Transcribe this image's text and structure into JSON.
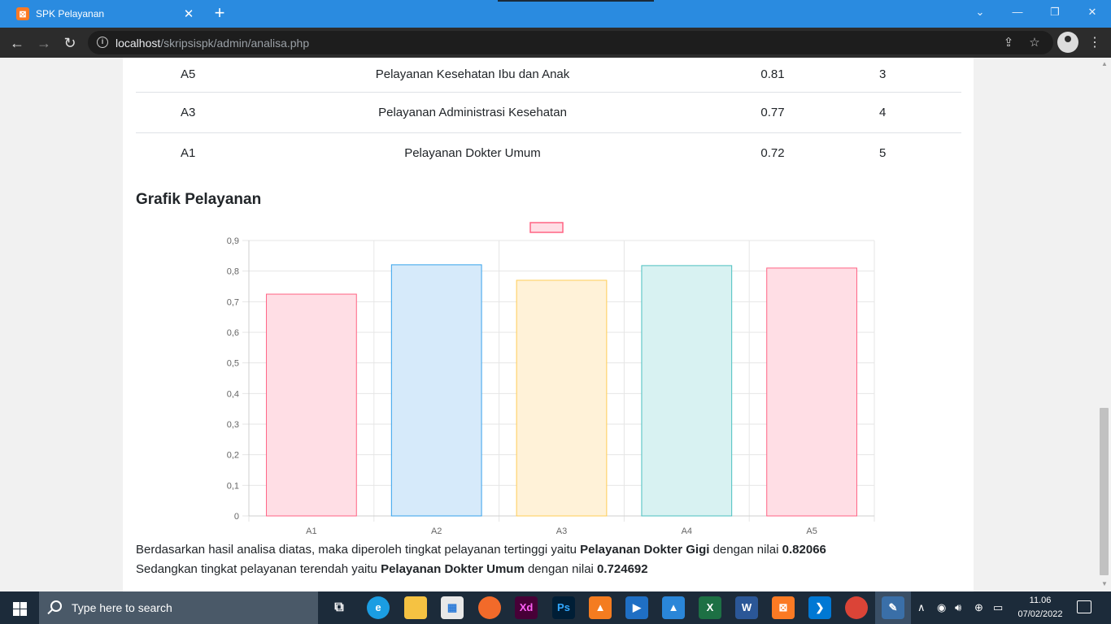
{
  "browser": {
    "tab_title": "SPK Pelayanan",
    "tab_favicon": "xampp-icon",
    "tab_close": "✕",
    "new_tab": "+",
    "url_host": "localhost",
    "url_path": "/skripsispk/admin/analisa.php"
  },
  "ranking_table": {
    "rows": [
      {
        "code": "A5",
        "name": "Pelayanan Kesehatan Ibu dan Anak",
        "value": "0.81",
        "rank": "3"
      },
      {
        "code": "A3",
        "name": "Pelayanan Administrasi Kesehatan",
        "value": "0.77",
        "rank": "4"
      },
      {
        "code": "A1",
        "name": "Pelayanan Dokter Umum",
        "value": "0.72",
        "rank": "5"
      }
    ]
  },
  "section_title": "Grafik Pelayanan",
  "chart_data": {
    "type": "bar",
    "categories": [
      "A1",
      "A2",
      "A3",
      "A4",
      "A5"
    ],
    "values": [
      0.724692,
      0.82066,
      0.77,
      0.818,
      0.81
    ],
    "ylim": [
      0,
      0.9
    ],
    "yticks": [
      "0",
      "0,1",
      "0,2",
      "0,3",
      "0,4",
      "0,5",
      "0,6",
      "0,7",
      "0,8",
      "0,9"
    ],
    "grid": true,
    "legend": "top-center",
    "fill_colors": [
      "#ffdee5",
      "#d6eafa",
      "#fff2d8",
      "#d8f2f2",
      "#ffdee5"
    ],
    "border_colors": [
      "#ff6384",
      "#36a2eb",
      "#ffcd56",
      "#4bc0c0",
      "#ff6384"
    ]
  },
  "summary": {
    "line1_prefix": "Berdasarkan hasil analisa diatas, maka diperoleh tingkat pelayanan tertinggi yaitu ",
    "line1_name": "Pelayanan Dokter Gigi",
    "line1_mid": " dengan nilai ",
    "line1_value": "0.82066",
    "line2_prefix": "Sedangkan tingkat pelayanan terendah yaitu ",
    "line2_name": "Pelayanan Dokter Umum",
    "line2_mid": " dengan nilai ",
    "line2_value": "0.724692"
  },
  "taskbar": {
    "search_placeholder": "Type here to search",
    "time": "11.06",
    "date": "07/02/2022",
    "apps": [
      "task-view",
      "edge",
      "file-explorer",
      "store",
      "firefox",
      "xd",
      "photoshop",
      "app-orange",
      "video",
      "photos",
      "excel",
      "word",
      "xampp",
      "vscode",
      "chrome",
      "tool"
    ],
    "xd_label": "Xd",
    "ps_label": "Ps"
  }
}
